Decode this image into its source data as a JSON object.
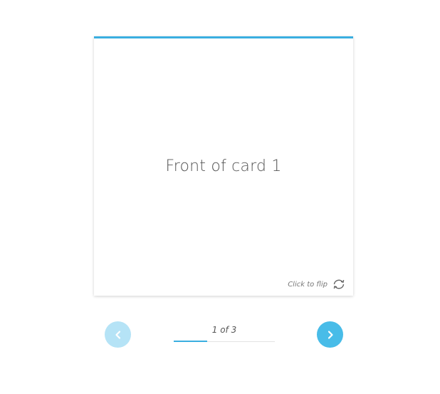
{
  "card": {
    "front_text": "Front of card 1",
    "flip_hint": "Click to flip",
    "flip_icon": "flip-refresh-icon"
  },
  "navigation": {
    "prev_icon": "chevron-left-icon",
    "next_icon": "chevron-right-icon",
    "prev_enabled": false,
    "next_enabled": true
  },
  "progress": {
    "text": "1 of 3",
    "current": 1,
    "total": 3,
    "fraction": 0.333
  },
  "colors": {
    "accent": "#3aaee0",
    "next_button": "#48bce8",
    "prev_button_disabled": "#b5e3f6",
    "text": "#555555"
  }
}
